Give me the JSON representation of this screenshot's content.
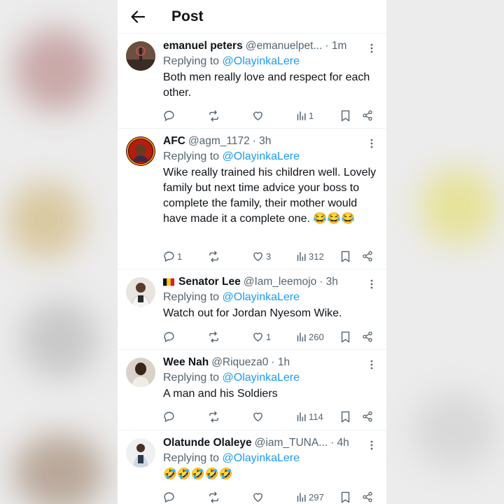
{
  "header": {
    "title": "Post"
  },
  "tweets": [
    {
      "name": "emanuel peters",
      "handle": "@emanuelpet...",
      "time": "· 1m",
      "replying_label": "Replying to",
      "replying_to": "@OlayinkaLere",
      "text": "Both men really love and respect for each other.",
      "replies": "",
      "reposts": "",
      "likes": "",
      "views": "1"
    },
    {
      "name": "AFC",
      "handle": "@agm_1172",
      "time": "· 3h",
      "replying_label": "Replying to",
      "replying_to": "@OlayinkaLere",
      "text": "Wike really trained his children well. Lovely family but next time advice your boss to complete the family, their mother would have made it a complete one. 😂😂😂",
      "replies": "1",
      "reposts": "",
      "likes": "3",
      "views": "312"
    },
    {
      "name": "Senator Lee",
      "handle": "@Iam_leemojo",
      "time": "· 3h",
      "replying_label": "Replying to",
      "replying_to": "@OlayinkaLere",
      "text": "Watch out for Jordan Nyesom Wike.",
      "replies": "",
      "reposts": "",
      "likes": "1",
      "views": "260"
    },
    {
      "name": "Wee Nah",
      "handle": "@Riqueza0",
      "time": "· 1h",
      "replying_label": "Replying to",
      "replying_to": "@OlayinkaLere",
      "text": "A man and his Soldiers",
      "replies": "",
      "reposts": "",
      "likes": "",
      "views": "114"
    },
    {
      "name": "Olatunde Olaleye",
      "handle": "@iam_TUNA...",
      "time": "· 4h",
      "replying_label": "Replying to",
      "replying_to": "@OlayinkaLere",
      "text": "🤣🤣🤣🤣🤣",
      "replies": "",
      "reposts": "",
      "likes": "",
      "views": "297"
    }
  ],
  "colors": {
    "link": "#1d9bf0",
    "muted": "#536471",
    "text": "#0f1419"
  },
  "icons": [
    "back-arrow-icon",
    "more-icon",
    "reply-icon",
    "repost-icon",
    "like-icon",
    "views-icon",
    "bookmark-icon",
    "share-icon",
    "belgium-flag-icon"
  ]
}
